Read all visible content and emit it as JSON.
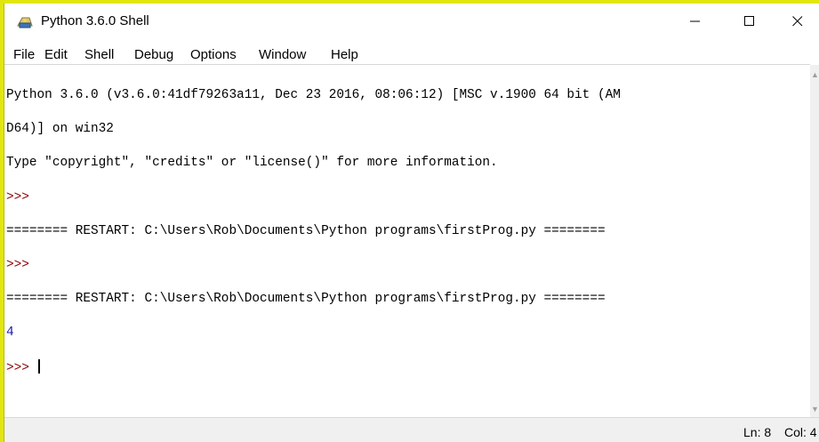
{
  "window": {
    "title": "Python 3.6.0 Shell"
  },
  "menu": [
    "File",
    "Edit",
    "Shell",
    "Debug",
    "Options",
    "Window",
    "Help"
  ],
  "shell": {
    "banner_line1": "Python 3.6.0 (v3.6.0:41df79263a11, Dec 23 2016, 08:06:12) [MSC v.1900 64 bit (AM",
    "banner_line2": "D64)] on win32",
    "banner_line3": "Type \"copyright\", \"credits\" or \"license()\" for more information.",
    "prompt": ">>>",
    "restart1": "======== RESTART: C:\\Users\\Rob\\Documents\\Python programs\\firstProg.py ========",
    "restart2": "======== RESTART: C:\\Users\\Rob\\Documents\\Python programs\\firstProg.py ========",
    "output": "4"
  },
  "status": {
    "line": "Ln: 8",
    "col": "Col: 4"
  },
  "colors": {
    "background": "#e2e610",
    "prompt": "#8b0000",
    "output": "#1a1aa6"
  }
}
